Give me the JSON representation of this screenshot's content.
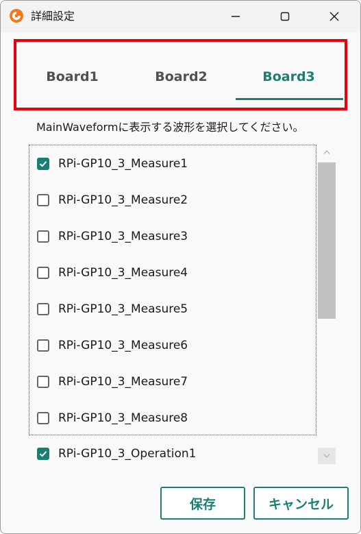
{
  "window": {
    "title": "詳細設定",
    "app_icon": "orange-ring-icon"
  },
  "titlebar_controls": {
    "minimize_icon": "minimize-icon",
    "maximize_icon": "maximize-icon",
    "close_icon": "close-icon"
  },
  "tabs": [
    {
      "label": "Board1",
      "selected": false
    },
    {
      "label": "Board2",
      "selected": false
    },
    {
      "label": "Board3",
      "selected": true
    }
  ],
  "instruction": "MainWaveformに表示する波形を選択してください。",
  "items": [
    {
      "label": "RPi-GP10_3_Measure1",
      "checked": true
    },
    {
      "label": "RPi-GP10_3_Measure2",
      "checked": false
    },
    {
      "label": "RPi-GP10_3_Measure3",
      "checked": false
    },
    {
      "label": "RPi-GP10_3_Measure4",
      "checked": false
    },
    {
      "label": "RPi-GP10_3_Measure5",
      "checked": false
    },
    {
      "label": "RPi-GP10_3_Measure6",
      "checked": false
    },
    {
      "label": "RPi-GP10_3_Measure7",
      "checked": false
    },
    {
      "label": "RPi-GP10_3_Measure8",
      "checked": false
    },
    {
      "label": "RPi-GP10_3_Operation1",
      "checked": true
    }
  ],
  "buttons": {
    "save_label": "保存",
    "cancel_label": "キャンセル"
  },
  "colors": {
    "accent": "#1a7f73",
    "highlight": "#e8000b",
    "app_icon": "#f07a1e"
  }
}
